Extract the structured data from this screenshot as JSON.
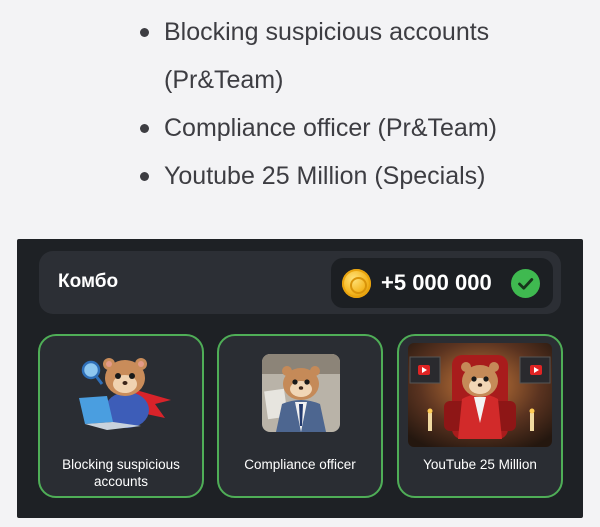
{
  "bullets": [
    "Blocking suspicious accounts (Pr&Team)",
    "Compliance officer (Pr&Team)",
    "Youtube 25 Million (Specials)"
  ],
  "combo": {
    "title": "Комбо",
    "reward": "+5 000 000",
    "coin_icon": "gold-coin-icon",
    "status_icon": "check-circle-icon",
    "status_color": "#3fb950"
  },
  "cards": [
    {
      "label": "Blocking suspicious accounts",
      "art": "hamster-hero-laptop"
    },
    {
      "label": "Compliance officer",
      "art": "hamster-office-suit"
    },
    {
      "label": "YouTube 25 Million",
      "art": "hamster-red-suit-throne"
    }
  ],
  "colors": {
    "panel_bg": "#1e2125",
    "card_border": "#4fae57",
    "text_dark": "#3d3d42"
  }
}
